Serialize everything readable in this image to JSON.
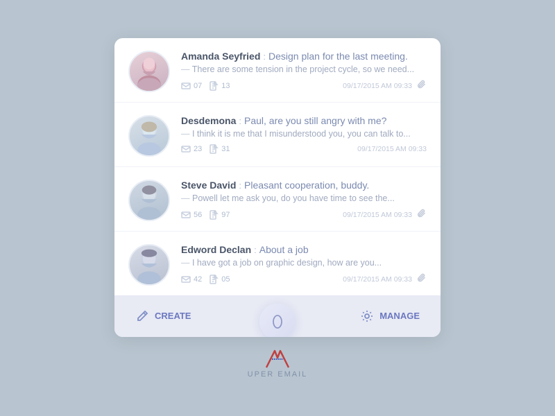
{
  "app": {
    "brand_name": "UPER EMAIL"
  },
  "messages": [
    {
      "id": 1,
      "sender": "Amanda Seyfried",
      "subject": "Design plan for the last meeting.",
      "preview": "There are some tension in the project cycle, so we need...",
      "mail_count": "07",
      "doc_count": "13",
      "date": "09/17/2015 AM 09:33",
      "has_attachment": true
    },
    {
      "id": 2,
      "sender": "Desdemona",
      "subject": "Paul, are you still angry with me?",
      "preview": "I think it is me that I misunderstood you, you can talk to...",
      "mail_count": "23",
      "doc_count": "31",
      "date": "09/17/2015 AM 09:33",
      "has_attachment": false
    },
    {
      "id": 3,
      "sender": "Steve David",
      "subject": "Pleasant cooperation, buddy.",
      "preview": "Powell let me ask you, do you have time to see the...",
      "mail_count": "56",
      "doc_count": "97",
      "date": "09/17/2015 AM 09:33",
      "has_attachment": true
    },
    {
      "id": 4,
      "sender": "Edword Declan",
      "subject": "About a job",
      "preview": "I have got a job on graphic design, how are you...",
      "mail_count": "42",
      "doc_count": "05",
      "date": "09/17/2015 AM 09:33",
      "has_attachment": true
    }
  ],
  "bottom_bar": {
    "create_label": "CREATE",
    "manage_label": "MANAGE"
  }
}
